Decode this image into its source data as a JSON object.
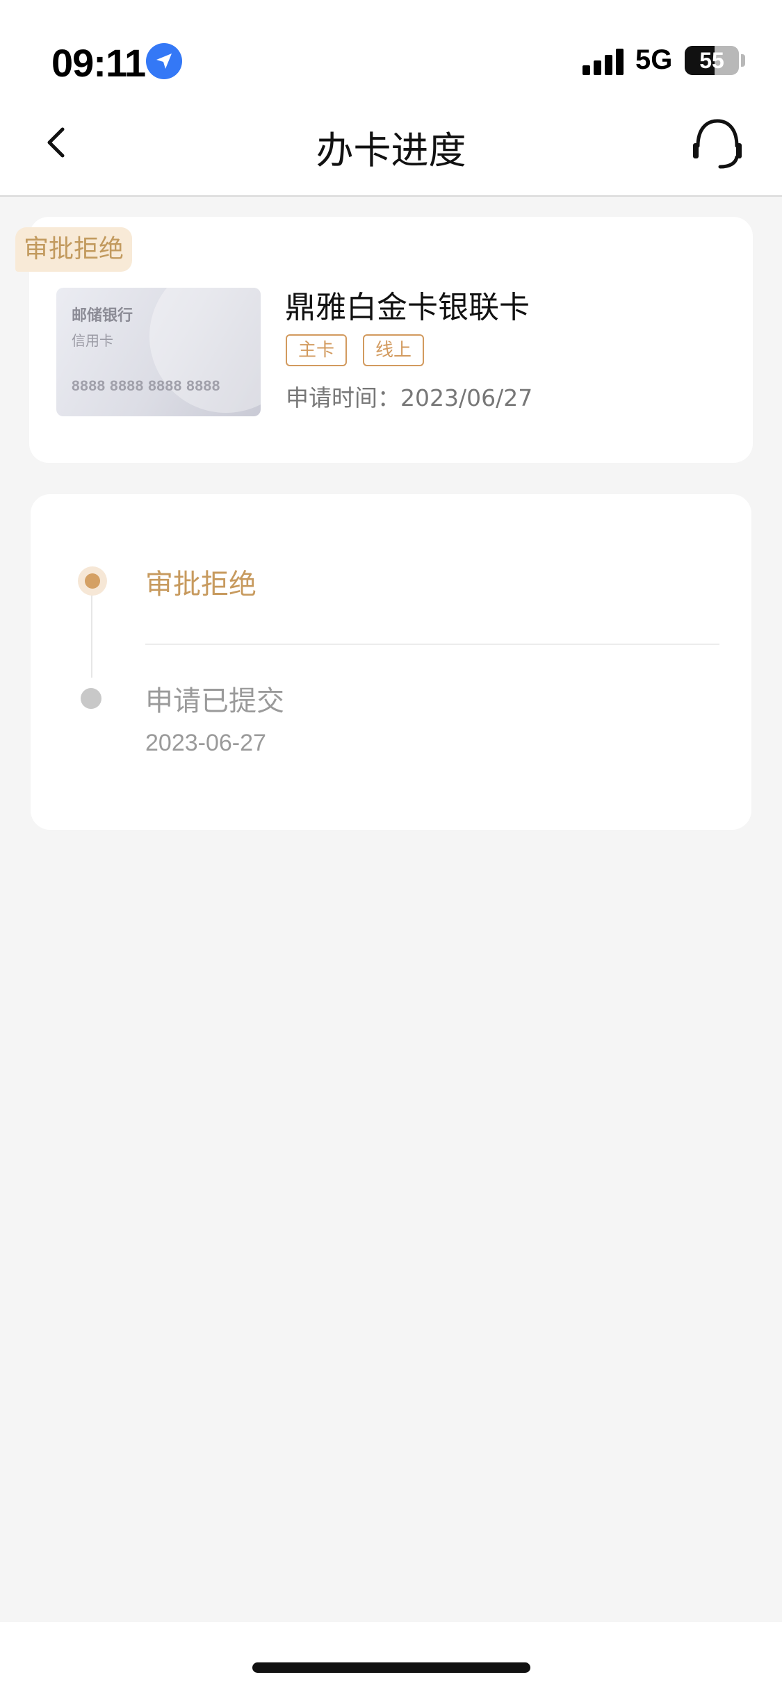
{
  "status_bar": {
    "time": "09:11",
    "network": "5G",
    "battery": "55",
    "battery_level": 0.55
  },
  "header": {
    "title": "办卡进度"
  },
  "card": {
    "status_tag": "审批拒绝",
    "bank_name": "邮储银行",
    "card_type": "信用卡",
    "card_number": "8888 8888 8888 8888",
    "product_name": "鼎雅白金卡银联卡",
    "badges": [
      "主卡",
      "线上"
    ],
    "apply_time": "申请时间：2023/06/27"
  },
  "timeline": {
    "steps": [
      {
        "title": "审批拒绝",
        "date": "",
        "active": true
      },
      {
        "title": "申请已提交",
        "date": "2023-06-27",
        "active": false
      }
    ]
  },
  "colors": {
    "accent": "#c79a5e",
    "tag_bg": "#f8ead7",
    "ios_blue": "#3478f6"
  }
}
